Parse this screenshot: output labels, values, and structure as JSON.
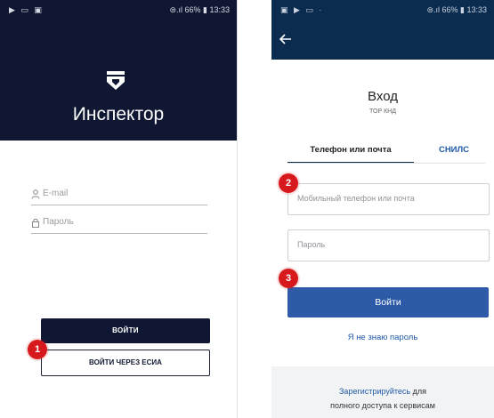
{
  "phone1": {
    "status_left": "▶ ▭ ▣",
    "status_right": "⊜.ıl 66% ▮ 13:33",
    "app_title": "Инспектор",
    "email_placeholder": "E-mail",
    "password_placeholder": "Пароль",
    "login_button": "ВОЙТИ",
    "esia_button": "ВОЙТИ ЧЕРЕЗ ЕСИА",
    "marker": "1",
    "icons": {
      "logo": "shield-logo-icon",
      "email": "user-icon",
      "password": "lock-icon"
    },
    "colors": {
      "header": "#0f1733",
      "button": "#0f1733",
      "marker": "#d7191d"
    }
  },
  "phone2": {
    "status_left": "▣ ▶ ▭ ·",
    "status_right": "⊜.ıl 66% ▮ 13:33",
    "title": "Вход",
    "subtitle": "ТОР КНД",
    "tabs": [
      "Телефон или почта",
      "СНИЛС"
    ],
    "active_tab": "Телефон или почта",
    "phone_placeholder": "Мобильный телефон или почта",
    "password_placeholder": "Пароль",
    "login_button": "Войти",
    "forgot_link": "Я не знаю пароль",
    "register_link": "Зарегистрируйтесь",
    "register_text_1": "для",
    "register_text_2": "полного доступа к сервисам",
    "markers": [
      "2",
      "3"
    ],
    "icons": {
      "back": "back-arrow-icon"
    },
    "colors": {
      "header": "#0b2b4f",
      "button": "#2d5ba8",
      "link": "#1f5aa8"
    }
  }
}
